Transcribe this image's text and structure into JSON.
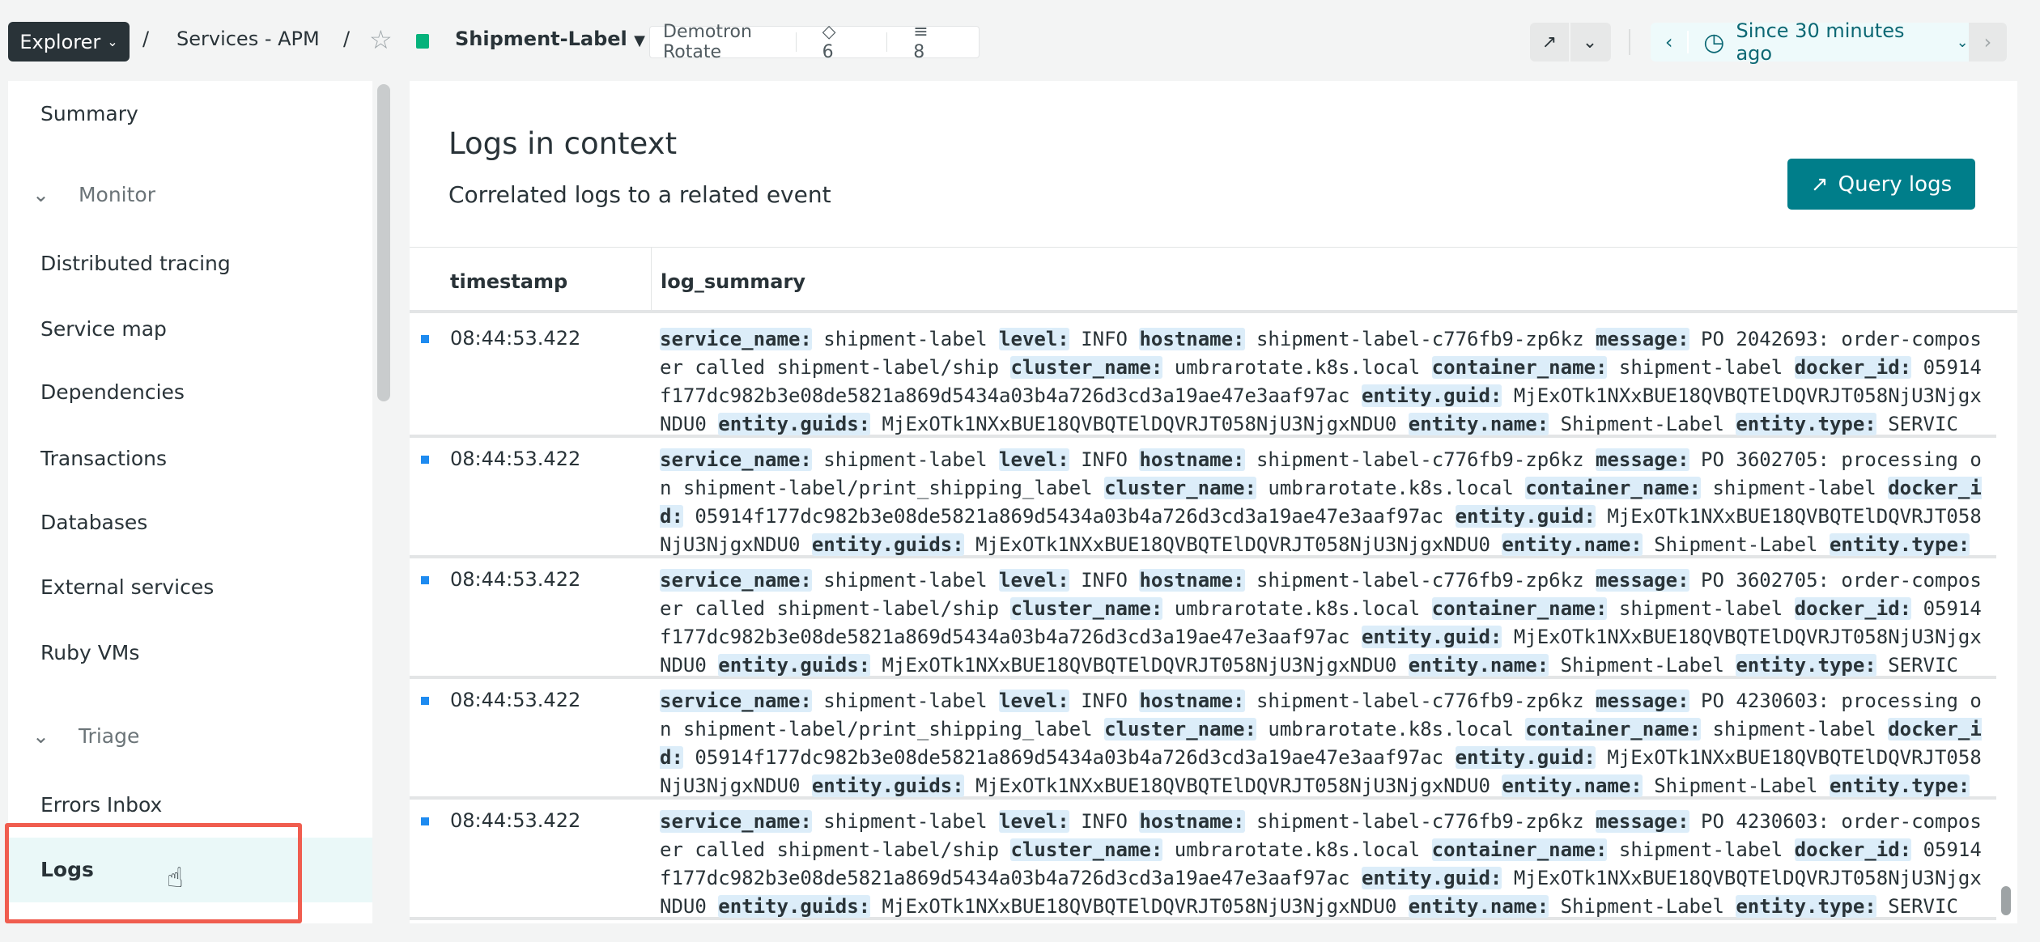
{
  "header": {
    "explorer_label": "Explorer",
    "breadcrumb_sep": "/",
    "breadcrumb_services": "Services - APM",
    "entity_name": "Shipment-Label",
    "entity_status_color": "#05b27b",
    "account": "Demotron Rotate",
    "tags_count": "6",
    "related_count": "8",
    "time_range": "Since 30 minutes ago"
  },
  "sidebar": {
    "summary": "Summary",
    "monitor": "Monitor",
    "monitor_items": [
      "Distributed tracing",
      "Service map",
      "Dependencies",
      "Transactions",
      "Databases",
      "External services",
      "Ruby VMs"
    ],
    "triage": "Triage",
    "triage_items": [
      "Errors Inbox",
      "Logs"
    ],
    "selected": "Logs"
  },
  "main": {
    "title": "Logs in context",
    "subtitle": "Correlated logs to a related event",
    "query_button": "Query logs",
    "columns": [
      "timestamp",
      "log_summary"
    ],
    "rows": [
      {
        "timestamp": "08:44:53.422",
        "fields": [
          [
            "service_name:",
            "shipment-label"
          ],
          [
            "level:",
            "INFO"
          ],
          [
            "hostname:",
            "shipment-label-c776fb9-zp6kz"
          ],
          [
            "message:",
            "PO 2042693: order-composer called shipment-label/ship"
          ],
          [
            "cluster_name:",
            "umbrarotate.k8s.local"
          ],
          [
            "container_name:",
            "shipment-label"
          ],
          [
            "docker_id:",
            "05914f177dc982b3e08de5821a869d5434a03b4a726d3cd3a19ae47e3aaf97ac"
          ],
          [
            "entity.guid:",
            "MjExOTk1NXxBUE18QVBQTElDQVRJT058NjU3NjgxNDU0"
          ],
          [
            "entity.guids:",
            "MjExOTk1NXxBUE18QVBQTElDQVRJT058NjU3NjgxNDU0"
          ],
          [
            "entity.name:",
            "Shipment-Label"
          ],
          [
            "entity.type:",
            "SERVIC"
          ]
        ]
      },
      {
        "timestamp": "08:44:53.422",
        "fields": [
          [
            "service_name:",
            "shipment-label"
          ],
          [
            "level:",
            "INFO"
          ],
          [
            "hostname:",
            "shipment-label-c776fb9-zp6kz"
          ],
          [
            "message:",
            "PO 3602705: processing on shipment-label/print_shipping_label"
          ],
          [
            "cluster_name:",
            "umbrarotate.k8s.local"
          ],
          [
            "container_name:",
            "shipment-label"
          ],
          [
            "docker_id:",
            "05914f177dc982b3e08de5821a869d5434a03b4a726d3cd3a19ae47e3aaf97ac"
          ],
          [
            "entity.guid:",
            "MjExOTk1NXxBUE18QVBQTElDQVRJT058NjU3NjgxNDU0"
          ],
          [
            "entity.guids:",
            "MjExOTk1NXxBUE18QVBQTElDQVRJT058NjU3NjgxNDU0"
          ],
          [
            "entity.name:",
            "Shipment-Label"
          ],
          [
            "entity.type:",
            ""
          ]
        ]
      },
      {
        "timestamp": "08:44:53.422",
        "fields": [
          [
            "service_name:",
            "shipment-label"
          ],
          [
            "level:",
            "INFO"
          ],
          [
            "hostname:",
            "shipment-label-c776fb9-zp6kz"
          ],
          [
            "message:",
            "PO 3602705: order-composer called shipment-label/ship"
          ],
          [
            "cluster_name:",
            "umbrarotate.k8s.local"
          ],
          [
            "container_name:",
            "shipment-label"
          ],
          [
            "docker_id:",
            "05914f177dc982b3e08de5821a869d5434a03b4a726d3cd3a19ae47e3aaf97ac"
          ],
          [
            "entity.guid:",
            "MjExOTk1NXxBUE18QVBQTElDQVRJT058NjU3NjgxNDU0"
          ],
          [
            "entity.guids:",
            "MjExOTk1NXxBUE18QVBQTElDQVRJT058NjU3NjgxNDU0"
          ],
          [
            "entity.name:",
            "Shipment-Label"
          ],
          [
            "entity.type:",
            "SERVIC"
          ]
        ]
      },
      {
        "timestamp": "08:44:53.422",
        "fields": [
          [
            "service_name:",
            "shipment-label"
          ],
          [
            "level:",
            "INFO"
          ],
          [
            "hostname:",
            "shipment-label-c776fb9-zp6kz"
          ],
          [
            "message:",
            "PO 4230603: processing on shipment-label/print_shipping_label"
          ],
          [
            "cluster_name:",
            "umbrarotate.k8s.local"
          ],
          [
            "container_name:",
            "shipment-label"
          ],
          [
            "docker_id:",
            "05914f177dc982b3e08de5821a869d5434a03b4a726d3cd3a19ae47e3aaf97ac"
          ],
          [
            "entity.guid:",
            "MjExOTk1NXxBUE18QVBQTElDQVRJT058NjU3NjgxNDU0"
          ],
          [
            "entity.guids:",
            "MjExOTk1NXxBUE18QVBQTElDQVRJT058NjU3NjgxNDU0"
          ],
          [
            "entity.name:",
            "Shipment-Label"
          ],
          [
            "entity.type:",
            ""
          ]
        ]
      },
      {
        "timestamp": "08:44:53.422",
        "fields": [
          [
            "service_name:",
            "shipment-label"
          ],
          [
            "level:",
            "INFO"
          ],
          [
            "hostname:",
            "shipment-label-c776fb9-zp6kz"
          ],
          [
            "message:",
            "PO 4230603: order-composer called shipment-label/ship"
          ],
          [
            "cluster_name:",
            "umbrarotate.k8s.local"
          ],
          [
            "container_name:",
            "shipment-label"
          ],
          [
            "docker_id:",
            "05914f177dc982b3e08de5821a869d5434a03b4a726d3cd3a19ae47e3aaf97ac"
          ],
          [
            "entity.guid:",
            "MjExOTk1NXxBUE18QVBQTElDQVRJT058NjU3NjgxNDU0"
          ],
          [
            "entity.guids:",
            "MjExOTk1NXxBUE18QVBQTElDQVRJT058NjU3NjgxNDU0"
          ],
          [
            "entity.name:",
            "Shipment-Label"
          ],
          [
            "entity.type:",
            "SERVIC"
          ]
        ]
      }
    ]
  },
  "colors": {
    "accent": "#007e8a",
    "level_marker": "#1e8bf0",
    "key_highlight": "#dcedf9",
    "selection_outline": "#f05d4f"
  }
}
